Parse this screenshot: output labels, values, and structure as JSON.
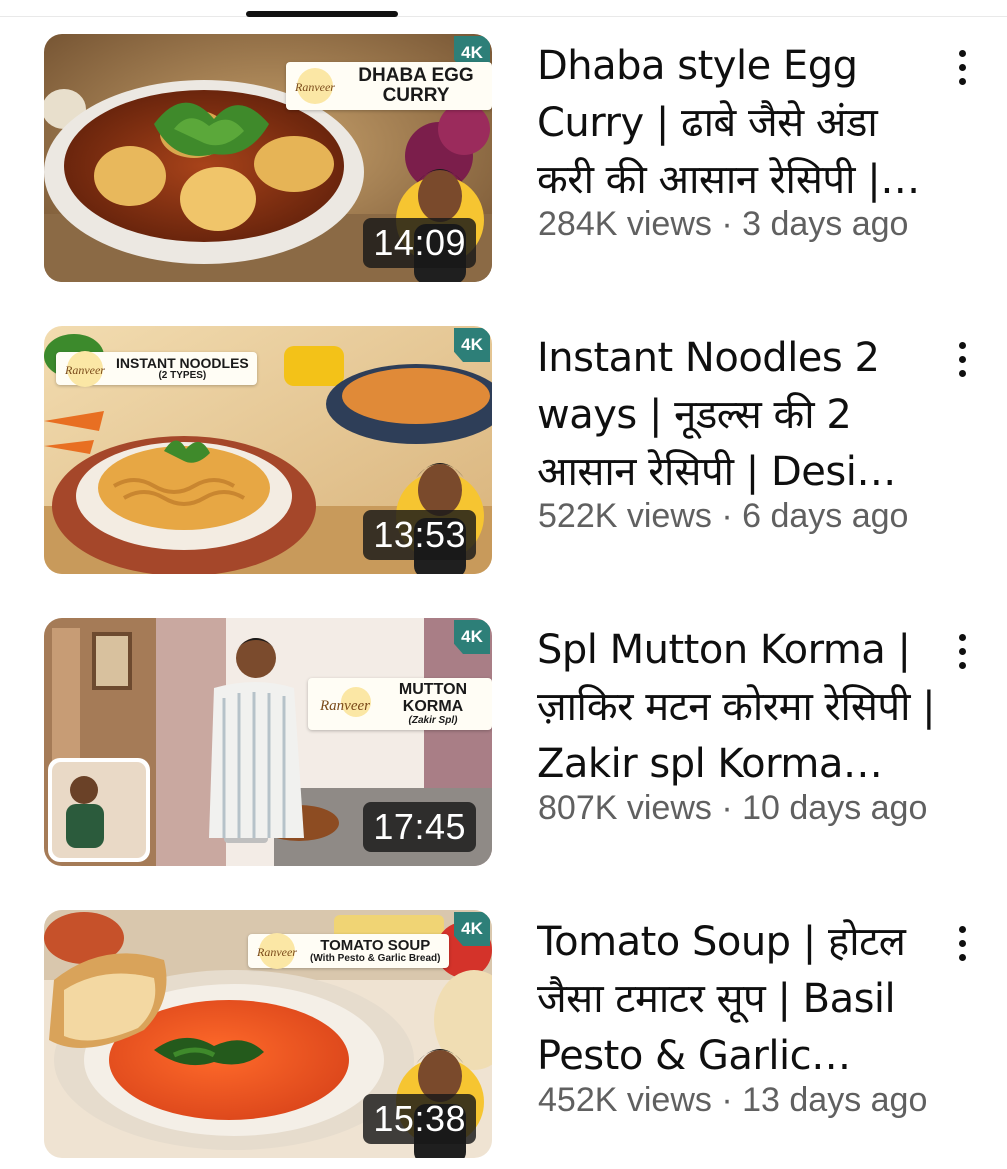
{
  "videos": [
    {
      "title": "Dhaba style Egg Curry | ढाबे जैसे अंडा करी की आसान रेसिपी | Dhaba style Egg Curry recipe",
      "views": "284K views",
      "age": "3 days ago",
      "duration": "14:09",
      "thumb_label": "DHABA EGG CURRY",
      "thumb_sub": "",
      "badge": "4K",
      "menu_icon": "more-vert-icon"
    },
    {
      "title": "Instant Noodles 2 ways | नूडल्स की 2 आसान रेसिपी | Desi style noodles",
      "views": "522K views",
      "age": "6 days ago",
      "duration": "13:53",
      "thumb_label": "INSTANT NOODLES",
      "thumb_sub": "(2 TYPES)",
      "badge": "4K",
      "menu_icon": "more-vert-icon"
    },
    {
      "title": "Spl Mutton Korma | ज़ाकिर मटन कोरमा रेसिपी | Zakir spl Korma recipe",
      "views": "807K views",
      "age": "10 days ago",
      "duration": "17:45",
      "thumb_label": "MUTTON KORMA",
      "thumb_sub": "(Zakir Spl)",
      "badge": "4K",
      "menu_icon": "more-vert-icon"
    },
    {
      "title": "Tomato Soup | होटल जैसा टमाटर सूप | Basil Pesto & Garlic Bread recipe",
      "views": "452K views",
      "age": "13 days ago",
      "duration": "15:38",
      "thumb_label": "TOMATO SOUP",
      "thumb_sub": "(With Pesto & Garlic Bread)",
      "badge": "4K",
      "menu_icon": "more-vert-icon"
    }
  ],
  "logo_text": "Ranveer",
  "colors": {
    "title": "#0f0f0f",
    "meta": "#606060",
    "badge": "#2d7f78",
    "duration_bg": "#191919",
    "chef_circle": "#f6c531"
  }
}
